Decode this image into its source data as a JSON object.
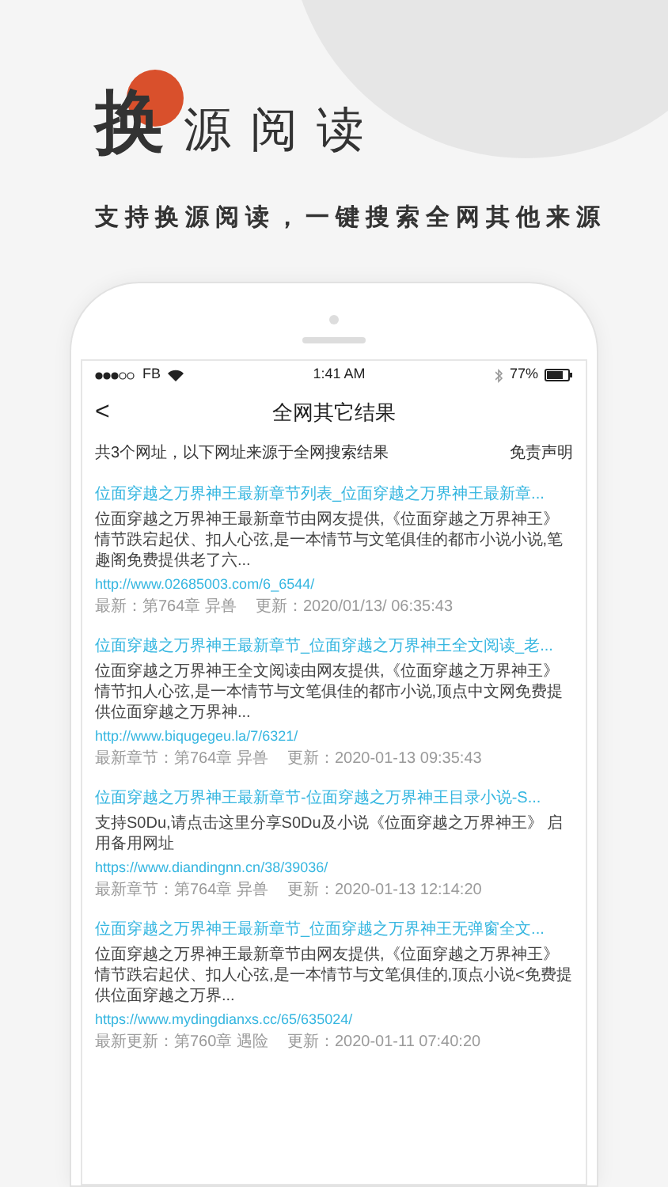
{
  "hero": {
    "title_first": "换",
    "title_rest": "源阅读",
    "subtitle": "支持换源阅读，一键搜索全网其他来源"
  },
  "status_bar": {
    "carrier": "FB",
    "time": "1:41 AM",
    "battery": "77%"
  },
  "nav": {
    "back": "<",
    "title": "全网其它结果"
  },
  "summary": {
    "text": "共3个网址，以下网址来源于全网搜索结果",
    "disclaimer": "免责声明"
  },
  "results": [
    {
      "title": "位面穿越之万界神王最新章节列表_位面穿越之万界神王最新章...",
      "description": "位面穿越之万界神王最新章节由网友提供,《位面穿越之万界神王》情节跌宕起伏、扣人心弦,是一本情节与文笔俱佳的都市小说小说,笔趣阁免费提供老了六...",
      "url": "http://www.02685003.com/6_6544/",
      "latest": "最新：第764章 异兽",
      "updated": "更新：2020/01/13/ 06:35:43"
    },
    {
      "title": "位面穿越之万界神王最新章节_位面穿越之万界神王全文阅读_老...",
      "description": "位面穿越之万界神王全文阅读由网友提供,《位面穿越之万界神王》情节扣人心弦,是一本情节与文笔俱佳的都市小说,顶点中文网免费提供位面穿越之万界神...",
      "url": "http://www.biqugegeu.la/7/6321/",
      "latest": "最新章节：第764章 异兽",
      "updated": "更新：2020-01-13 09:35:43"
    },
    {
      "title": "位面穿越之万界神王最新章节-位面穿越之万界神王目录小说-S...",
      "description": "支持S0Du,请点击这里分享S0Du及小说《位面穿越之万界神王》 启用备用网址",
      "url": "https://www.diandingnn.cn/38/39036/",
      "latest": "最新章节：第764章 异兽",
      "updated": "更新：2020-01-13 12:14:20"
    },
    {
      "title": "位面穿越之万界神王最新章节_位面穿越之万界神王无弹窗全文...",
      "description": "位面穿越之万界神王最新章节由网友提供,《位面穿越之万界神王》情节跌宕起伏、扣人心弦,是一本情节与文笔俱佳的,顶点小说<免费提供位面穿越之万界...",
      "url": "https://www.mydingdianxs.cc/65/635024/",
      "latest": "最新更新：第760章 遇险",
      "updated": "更新：2020-01-11 07:40:20"
    }
  ]
}
